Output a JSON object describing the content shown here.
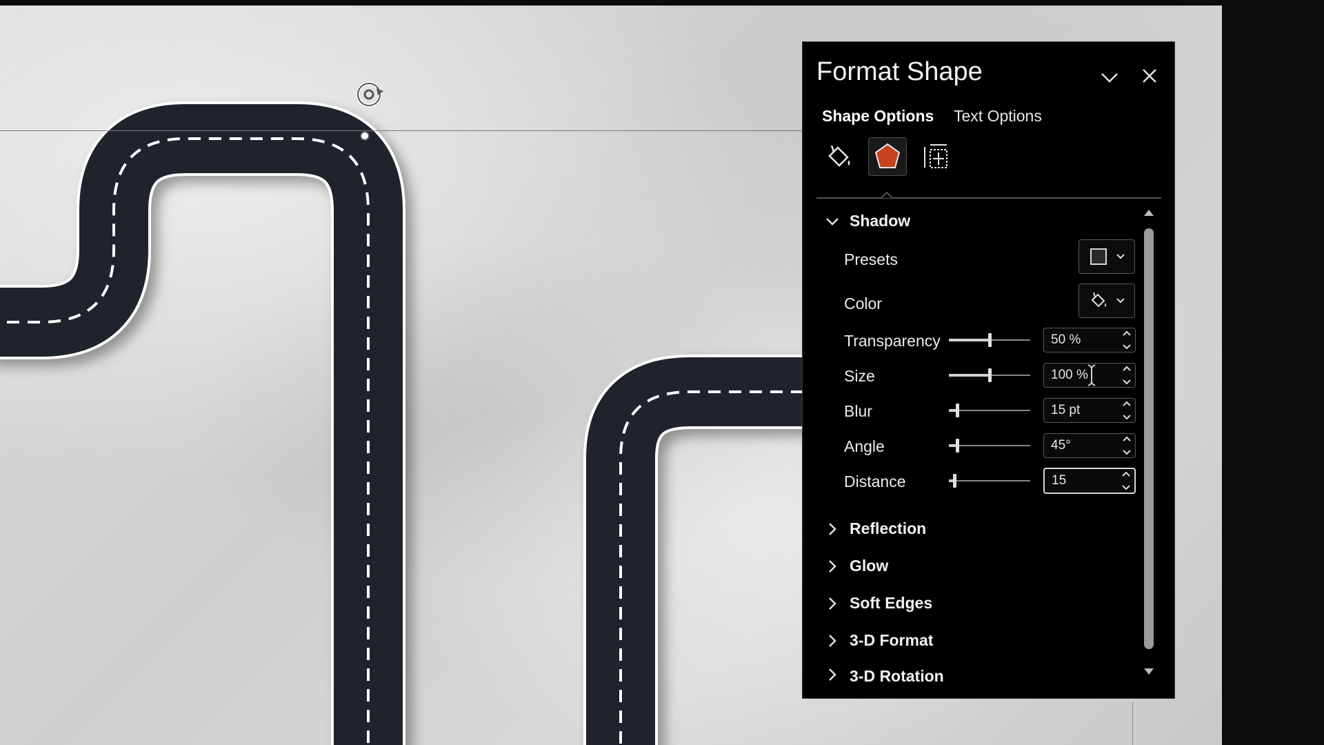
{
  "pane": {
    "title": "Format Shape",
    "tabs": [
      {
        "label": "Shape Options",
        "active": true
      },
      {
        "label": "Text Options",
        "active": false
      }
    ],
    "category_icons": [
      "fill-line-icon",
      "effects-pentagon-icon",
      "size-properties-icon"
    ],
    "selected_category": "effects",
    "accent_color": "#c8421e"
  },
  "shadow": {
    "header": "Shadow",
    "expanded": true,
    "presets_label": "Presets",
    "color_label": "Color",
    "transparency": {
      "label": "Transparency",
      "value": "50 %",
      "level": 0.5
    },
    "size": {
      "label": "Size",
      "value": "100 %",
      "level": 0.5
    },
    "blur": {
      "label": "Blur",
      "value": "15 pt",
      "level": 0.1
    },
    "angle": {
      "label": "Angle",
      "value": "45°",
      "level": 0.1
    },
    "distance": {
      "label": "Distance",
      "value": "15",
      "level": 0.07
    }
  },
  "sections": {
    "reflection": "Reflection",
    "glow": "Glow",
    "soft_edges": "Soft Edges",
    "format_3d": "3-D Format",
    "rotation_3d": "3-D Rotation"
  }
}
